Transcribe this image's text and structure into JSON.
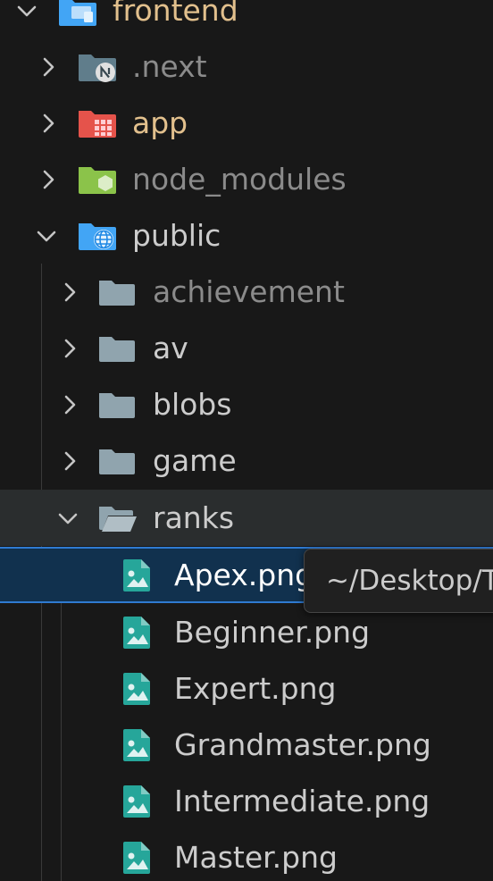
{
  "explorer": {
    "items": [
      {
        "label": "frontend",
        "icon": "frontend-folder-icon",
        "expanded": true
      },
      {
        "label": ".next",
        "icon": "nextjs-folder-icon",
        "expanded": false
      },
      {
        "label": "app",
        "icon": "app-folder-icon",
        "expanded": false
      },
      {
        "label": "node_modules",
        "icon": "node-folder-icon",
        "expanded": false
      },
      {
        "label": "public",
        "icon": "public-folder-icon",
        "expanded": true
      },
      {
        "label": "achievement",
        "icon": "folder-icon",
        "expanded": false
      },
      {
        "label": "av",
        "icon": "folder-icon",
        "expanded": false
      },
      {
        "label": "blobs",
        "icon": "folder-icon",
        "expanded": false
      },
      {
        "label": "game",
        "icon": "folder-icon",
        "expanded": false
      },
      {
        "label": "ranks",
        "icon": "folder-open-icon",
        "expanded": true
      },
      {
        "label": "Apex.png",
        "icon": "image-file-icon",
        "selected": true
      },
      {
        "label": "Beginner.png",
        "icon": "image-file-icon"
      },
      {
        "label": "Expert.png",
        "icon": "image-file-icon"
      },
      {
        "label": "Grandmaster.png",
        "icon": "image-file-icon"
      },
      {
        "label": "Intermediate.png",
        "icon": "image-file-icon"
      },
      {
        "label": "Master.png",
        "icon": "image-file-icon"
      }
    ]
  },
  "tooltip": {
    "text": "~/Desktop/T"
  },
  "colors": {
    "background": "#181818",
    "selection": "#11314e",
    "selection_border": "#2f7ad1",
    "hover": "#2a2d2e",
    "folder_gray": "#90a4ae",
    "app_red": "#e5534b",
    "node_green": "#8bc34a",
    "public_blue": "#42a5f5",
    "image_teal": "#26a69a",
    "gitignored_gold": "#e2c08d"
  }
}
